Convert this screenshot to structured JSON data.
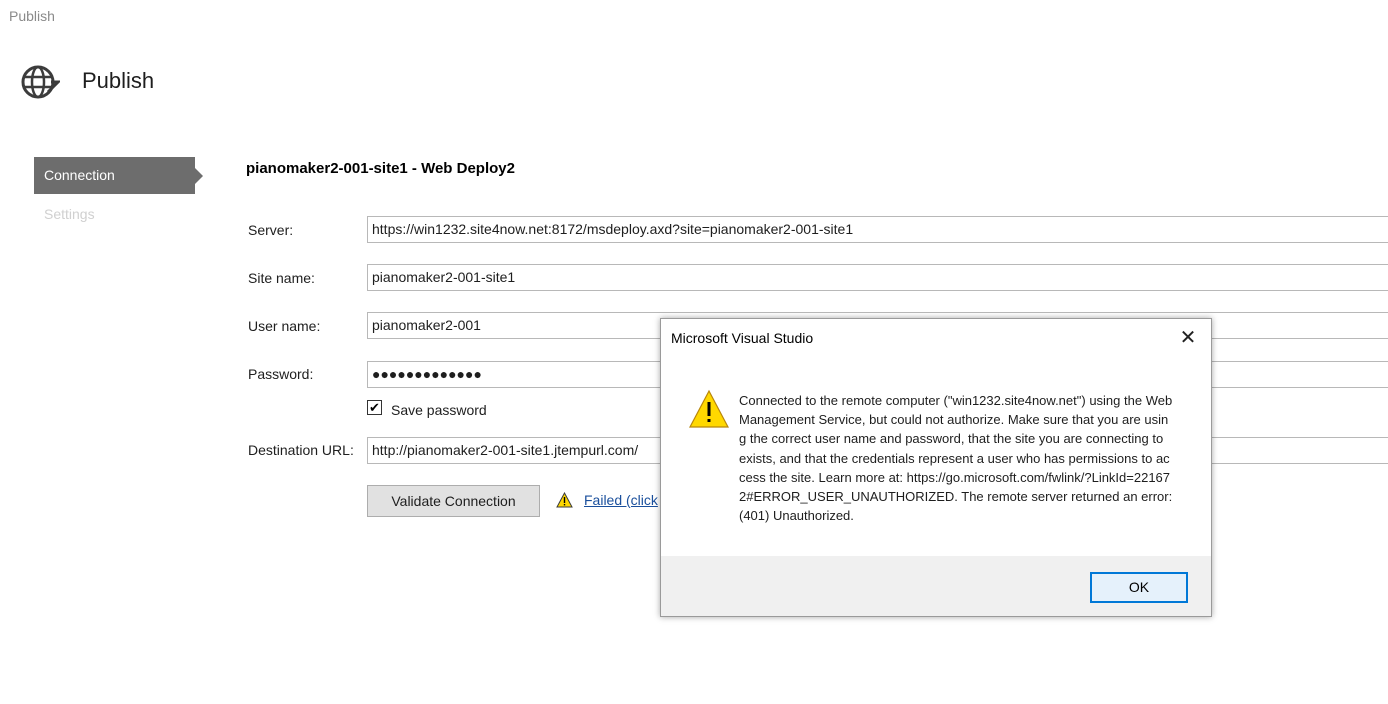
{
  "window": {
    "title": "Publish"
  },
  "header": {
    "title": "Publish",
    "icon": "globe-publish-icon"
  },
  "nav": {
    "items": [
      {
        "label": "Connection",
        "active": true
      },
      {
        "label": "Settings",
        "active": false
      }
    ]
  },
  "profile": {
    "title": "pianomaker2-001-site1 - Web Deploy2"
  },
  "form": {
    "server": {
      "label": "Server:",
      "value": "https://win1232.site4now.net:8172/msdeploy.axd?site=pianomaker2-001-site1"
    },
    "site_name": {
      "label": "Site name:",
      "value": "pianomaker2-001-site1"
    },
    "user_name": {
      "label": "User name:",
      "value": "pianomaker2-001"
    },
    "password": {
      "label": "Password:",
      "value": "●●●●●●●●●●●●●"
    },
    "save_password": {
      "label": "Save password",
      "checked": true,
      "check_glyph": "✔"
    },
    "destination_url": {
      "label": "Destination URL:",
      "value": "http://pianomaker2-001-site1.jtempurl.com/"
    },
    "validate_button": "Validate Connection",
    "status_link": "Failed (click"
  },
  "dialog": {
    "title": "Microsoft Visual Studio",
    "close_glyph": "✕",
    "icon": "warning-icon",
    "message": "Connected to the remote computer (\"win1232.site4now.net\") using the Web Management Service, but could not authorize. Make sure that you are using the correct user name and password, that the site you are connecting to exists, and that the credentials represent a user who has permissions to access the site.  Learn more at: https://go.microsoft.com/fwlink/?LinkId=221672#ERROR_USER_UNAUTHORIZED. The remote server returned an error: (401) Unauthorized.",
    "ok_button": "OK"
  },
  "colors": {
    "nav_active_bg": "#6d6d6d",
    "link": "#1a4f9c",
    "warning_yellow": "#ffd800",
    "accent_focus": "#0078d7"
  }
}
